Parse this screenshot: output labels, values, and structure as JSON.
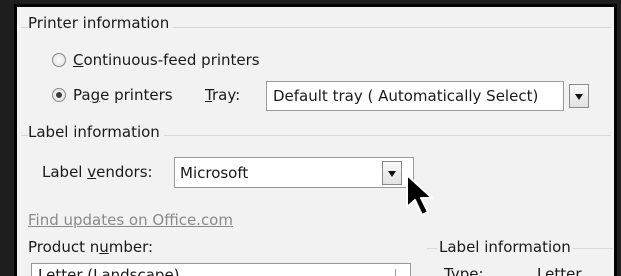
{
  "printer_info": {
    "heading": "Printer information",
    "continuous_label": "Continuous-feed printers",
    "page_label": "Page printers",
    "selected": "page",
    "tray_label": "Tray:",
    "tray_value": "Default tray ( Automatically Select)"
  },
  "label_info": {
    "heading": "Label information",
    "vendors_label": "Label vendors:",
    "vendors_value": "Microsoft",
    "find_updates_link": "Find updates on Office.com",
    "product_number_label": "Product number:",
    "product_value": "Letter (Landscape)",
    "right_heading": "Label information",
    "type_label": "Type:",
    "type_value": "Letter"
  },
  "icons": {
    "dropdown": "chevron-down-icon",
    "cursor": "mouse-pointer-icon"
  },
  "colors": {
    "background": "#f2f2f2",
    "link": "#8a8a8a",
    "frame": "#000000"
  }
}
